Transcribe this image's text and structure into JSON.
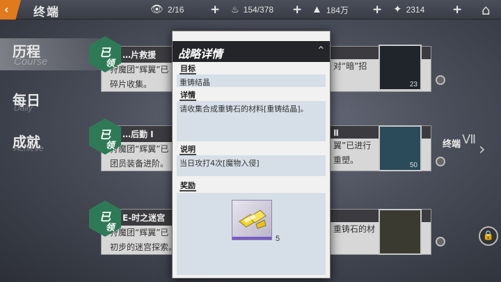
{
  "header": {
    "title": "终端",
    "resources": [
      {
        "icon": "eye-icon",
        "glyph": "👁",
        "value": "2/16"
      },
      {
        "icon": "flame-icon",
        "glyph": "🔥",
        "value": "154/378"
      },
      {
        "icon": "mountain-icon",
        "glyph": "▲",
        "value": "184万"
      },
      {
        "icon": "crystal-icon",
        "glyph": "✦",
        "value": "2314"
      }
    ]
  },
  "nav": {
    "items": [
      {
        "label": "历程",
        "sub": "Course"
      },
      {
        "label": "每日",
        "sub": "Daily"
      },
      {
        "label": "成就",
        "sub": "Achieve"
      }
    ]
  },
  "cards": [
    {
      "badge": "已领",
      "title": "…片救援",
      "text1": "狩魔团“辉翼”已",
      "text2": "碎片收集。"
    },
    {
      "badge": "已领",
      "title": "…后勤 Ⅰ",
      "text1": "狩魔团“辉翼”已",
      "text2": "团员装备进阶。"
    },
    {
      "badge": "已领",
      "title": "E-时之迷宫",
      "text1": "狩魔团“辉翼”已",
      "text2": "初步的迷宫探索。"
    }
  ],
  "right_cards": [
    {
      "title": "",
      "text1": "对“暗”招",
      "text2": "",
      "num": "23"
    },
    {
      "title": "Ⅱ",
      "text1": "翼”已进行",
      "text2": "重塑。",
      "num": "50"
    },
    {
      "title": "",
      "text1": "重铸石的材",
      "text2": "",
      "num": ""
    }
  ],
  "tier": {
    "label": "终端",
    "numeral": "Ⅶ"
  },
  "modal": {
    "title": "战略详情",
    "target_label": "目标",
    "target_value": "重铸结晶",
    "detail_label": "详情",
    "detail_value": "请收集合成重铸石的材料[重铸结晶]。",
    "note_label": "说明",
    "note_value": "当日攻打4次[魔物入侵]",
    "reward_label": "奖励",
    "reward_qty": "5"
  }
}
